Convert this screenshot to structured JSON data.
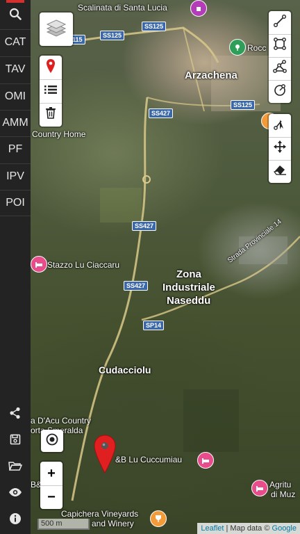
{
  "sidebar": {
    "search_icon": "search-icon",
    "items": [
      {
        "label": "CAT"
      },
      {
        "label": "TAV"
      },
      {
        "label": "OMI"
      },
      {
        "label": "AMM"
      },
      {
        "label": "PF"
      },
      {
        "label": "IPV"
      },
      {
        "label": "POI"
      }
    ],
    "bottom_icons": [
      "share-icon",
      "save-icon",
      "folder-open-icon",
      "eye-icon",
      "info-icon"
    ]
  },
  "map": {
    "places": [
      {
        "name": "Scalinata di Santa Lucia"
      },
      {
        "name": "Arzachena"
      },
      {
        "name": "Country Home"
      },
      {
        "name": "Stazzo Lu Ciaccaru"
      },
      {
        "name": "Zona"
      },
      {
        "name": "Industriale"
      },
      {
        "name": "Naseddu"
      },
      {
        "name": "Strada Provinciale 14"
      },
      {
        "name": "Cudacciolu"
      },
      {
        "name": "a D'Acu Country"
      },
      {
        "name": "orta Smeralda"
      },
      {
        "name": "&B Lu Cuccumiau"
      },
      {
        "name": "Capichera Vineyards"
      },
      {
        "name": "and Winery"
      },
      {
        "name": "Agritu"
      },
      {
        "name": "di Muz"
      },
      {
        "name": "Rocc"
      },
      {
        "name": "B&"
      }
    ],
    "road_shields": [
      "SS125",
      "SS125",
      "SS125",
      "115",
      "SS427",
      "SS427",
      "SS427",
      "SP14",
      "SS125"
    ],
    "scale_label": "500 m",
    "attribution": {
      "leaflet": "Leaflet",
      "separator": " | Map data © ",
      "google": "Google"
    }
  },
  "controls": {
    "layers_icon": "layers-icon",
    "left_tools": [
      "marker-icon",
      "list-icon",
      "trash-icon"
    ],
    "right_tools_top": [
      "draw-line-icon",
      "draw-rectangle-icon",
      "draw-polygon-icon",
      "draw-circle-icon"
    ],
    "right_tools_bottom": [
      "cut-icon",
      "move-icon",
      "eraser-icon"
    ],
    "locate_icon": "locate-icon",
    "zoom_in": "+",
    "zoom_out": "−"
  },
  "colors": {
    "sidebar_bg": "#232323",
    "accent": "#d32f2f",
    "road_shield": "#3a68a8",
    "poi_hotel": "#e84c8a",
    "poi_winery": "#f29b38",
    "poi_green": "#2e9e58"
  }
}
